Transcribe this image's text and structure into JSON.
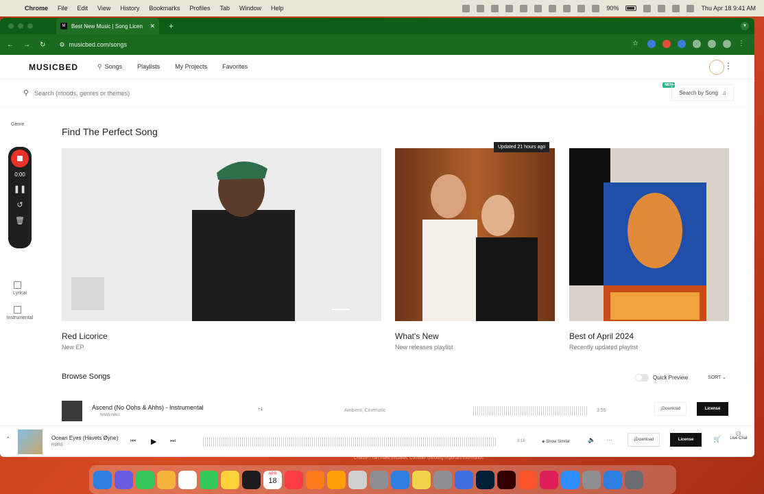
{
  "menubar": {
    "items": [
      "Chrome",
      "File",
      "Edit",
      "View",
      "History",
      "Bookmarks",
      "Profiles",
      "Tab",
      "Window",
      "Help"
    ],
    "battery": "90%",
    "datetime": "Thu Apr 18  9:41 AM"
  },
  "browser": {
    "tab_title": "Best New Music | Song Licen",
    "tab_favicon": "M",
    "url": "musicbed.com/songs"
  },
  "site": {
    "logo": "MUSICBED",
    "nav": [
      "Songs",
      "Playlists",
      "My Projects",
      "Favorites"
    ],
    "search_placeholder": "Search (moods, genres or themes)",
    "search_by_song": "Search by Song",
    "new_badge": "NEW"
  },
  "sidebar": {
    "genre_label": "Genre",
    "recorder_time": "0:00",
    "lyrical_label": "Lyrical",
    "instrumental_label": "Instrumental"
  },
  "featured": {
    "section_title": "Find The Perfect Song",
    "updated_badge": "Updated 21 hours ago",
    "cards": [
      {
        "title": "Red Licorice",
        "subtitle": "New EP"
      },
      {
        "title": "What's New",
        "subtitle": "New releases playlist"
      },
      {
        "title": "Best of April 2024",
        "subtitle": "Recently updated playlist"
      }
    ]
  },
  "browse": {
    "title": "Browse Songs",
    "quick_preview": "Quick Preview",
    "sort": "SORT",
    "songs": [
      {
        "name": "Ascend (No Oohs & Ahhs) - Instrumental",
        "artist": "WARS HAEL",
        "extra": "+1",
        "tags": "Ambient,   Cinematic",
        "duration": "3:55",
        "download": "Download",
        "license": "License"
      }
    ]
  },
  "player": {
    "title": "Ocean Eyes (Havets Øyne)",
    "artist": "RØRE",
    "time": "3:16",
    "show_similar": "Show Similar",
    "download": "Download",
    "license": "License",
    "live_chat": "Live Chat"
  },
  "disclaimer": "ChatGPT can make mistakes. Consider checking important information.",
  "dock": {
    "calendar_month": "APR",
    "calendar_day": "18",
    "colors": [
      "#2f7fe0",
      "#6a5ce0",
      "#34c759",
      "#f2b43a",
      "#ffffff",
      "#34c759",
      "#ffd23a",
      "#1c1c1e",
      "#1c1c1e",
      "#fc3c44",
      "#ff7a1a",
      "#ff9f0a",
      "#d0d0d0",
      "#8e8e93",
      "#2f7fe0",
      "#f2d24a",
      "#8e8e93",
      "#3f6fe0",
      "#001e36",
      "#330000",
      "#fb542b",
      "#e01e5a",
      "#2d8cff",
      "#8e8e93",
      "#2f7fe0",
      "#6c6c70"
    ]
  }
}
